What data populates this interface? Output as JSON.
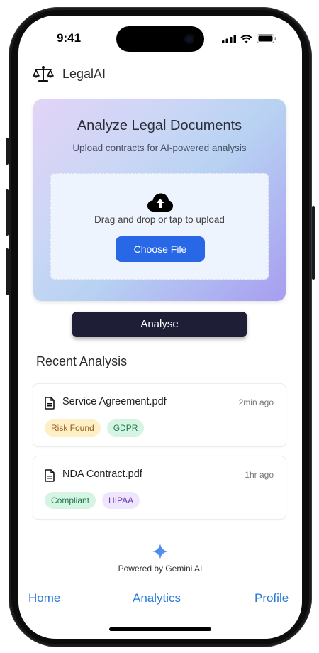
{
  "status_bar": {
    "time": "9:41"
  },
  "app": {
    "title": "LegalAI"
  },
  "hero": {
    "title": "Analyze Legal Documents",
    "subtitle": "Upload contracts for AI-powered analysis",
    "drop_text": "Drag and drop or tap to upload",
    "choose_label": "Choose File"
  },
  "analyse_label": "Analyse",
  "recent": {
    "title": "Recent Analysis",
    "items": [
      {
        "name": "Service Agreement.pdf",
        "time": "2min ago",
        "tags": [
          {
            "label": "Risk Found",
            "kind": "warn"
          },
          {
            "label": "GDPR",
            "kind": "green"
          }
        ]
      },
      {
        "name": "NDA Contract.pdf",
        "time": "1hr ago",
        "tags": [
          {
            "label": "Compliant",
            "kind": "green"
          },
          {
            "label": "HIPAA",
            "kind": "purple"
          }
        ]
      }
    ]
  },
  "powered_by": "Powered by Gemini AI",
  "nav": {
    "home": "Home",
    "analytics": "Analytics",
    "profile": "Profile"
  },
  "colors": {
    "primary_blue": "#2868e6",
    "analyse_dark": "#1e1e36",
    "nav_blue": "#2a7bd4",
    "gemini_star": "#4a85f0"
  },
  "icons": {
    "logo": "scales-icon",
    "upload": "cloud-upload-icon",
    "document": "document-icon",
    "gemini": "gemini-star-icon"
  }
}
